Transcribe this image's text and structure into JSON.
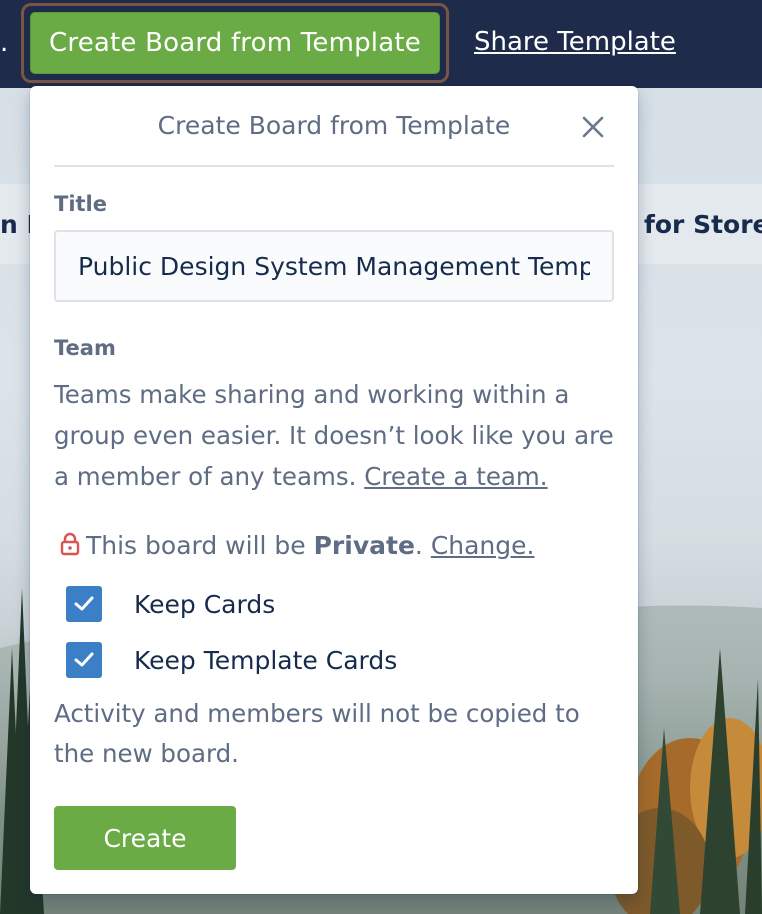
{
  "topbar": {
    "ellipsis": ".",
    "create_board_button": "Create Board from Template",
    "share_link": "Share Template"
  },
  "background": {
    "tile_left_text": "n I",
    "tile_right_text": "for Store"
  },
  "popover": {
    "title": "Create Board from Template",
    "title_label": "Title",
    "title_value": "Public Design System Management Template",
    "team_label": "Team",
    "team_text": "Teams make sharing and working within a group even easier. It doesn’t look like you are a member of any teams.",
    "create_team_link": "Create a team.",
    "visibility_prefix": "This board will be",
    "visibility_value": "Private",
    "visibility_period": ".",
    "change_link": "Change.",
    "options": [
      {
        "label": "Keep Cards",
        "checked": true
      },
      {
        "label": "Keep Template Cards",
        "checked": true
      }
    ],
    "note": "Activity and members will not be copied to the new board.",
    "create_button": "Create"
  },
  "colors": {
    "nav_bg": "#1e2b4a",
    "primary_green": "#6aab46",
    "focus_ring": "#7a5546",
    "checkbox_blue": "#3b80c6",
    "lock_red": "#d9534f"
  },
  "icons": [
    "close-icon",
    "lock-icon",
    "checkmark-icon"
  ]
}
